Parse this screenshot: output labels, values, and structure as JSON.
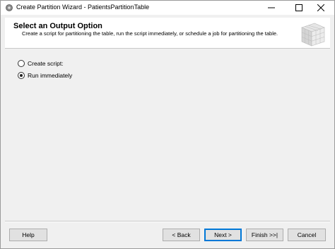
{
  "window": {
    "title": "Create Partition Wizard - PatientsPartitionTable",
    "icons": {
      "app": "gear-icon",
      "minimize": "minimize-icon",
      "maximize": "maximize-icon",
      "close": "close-icon"
    }
  },
  "header": {
    "title": "Select an Output Option",
    "description": "Create a script for partitioning the table, run the script immediately, or schedule a job for partitioning the table.",
    "graphic": "cube-grid-icon"
  },
  "options": [
    {
      "label": "Create script:",
      "selected": false
    },
    {
      "label": "Run immediately",
      "selected": true
    }
  ],
  "buttons": {
    "help": "Help",
    "back": "< Back",
    "next": "Next >",
    "finish": "Finish >>|",
    "cancel": "Cancel"
  },
  "colors": {
    "accent": "#0078d7",
    "background": "#f0f0f0"
  }
}
